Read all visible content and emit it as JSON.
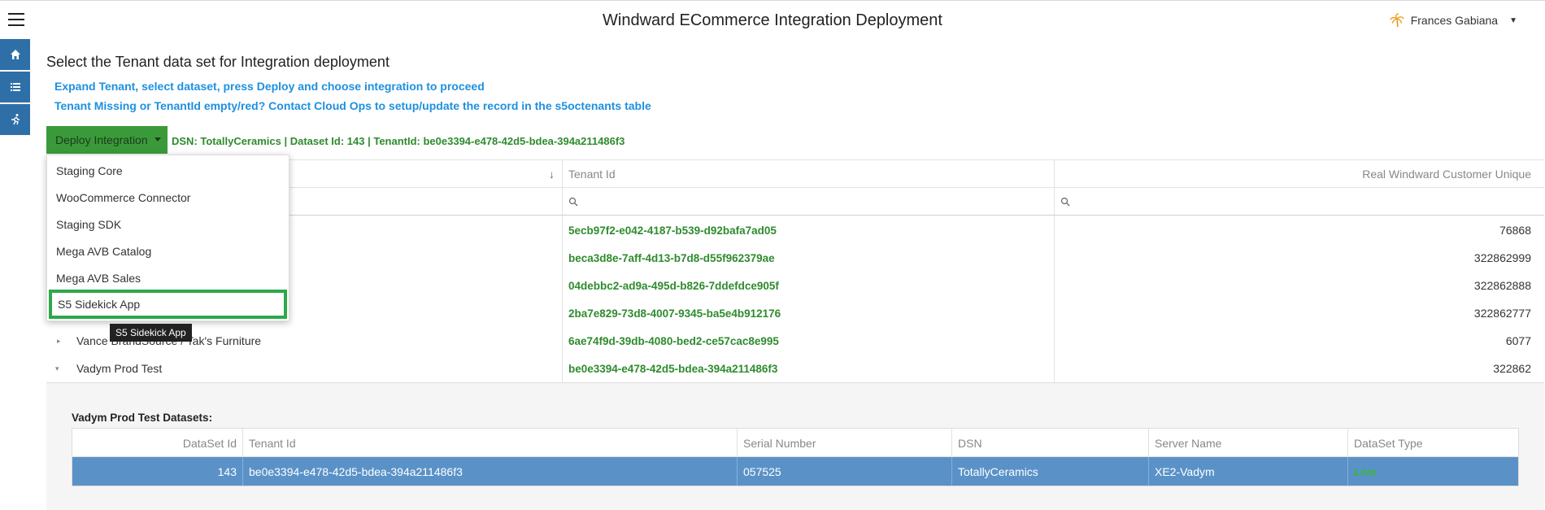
{
  "header": {
    "title": "Windward ECommerce Integration Deployment",
    "user_name": "Frances Gabiana"
  },
  "sidenav": {
    "items": [
      {
        "icon": "home-icon"
      },
      {
        "icon": "list-icon"
      },
      {
        "icon": "runner-icon"
      }
    ]
  },
  "page": {
    "heading": "Select the Tenant data set for Integration deployment",
    "info_line1": "Expand Tenant, select dataset, press Deploy and choose integration to proceed",
    "info_line2": "Tenant Missing or TenantId empty/red? Contact Cloud Ops to setup/update the record in the s5octenants table"
  },
  "deploy": {
    "button_label": "Deploy Integration",
    "dsn_info": "DSN: TotallyCeramics | Dataset Id: 143 | TenantId: be0e3394-e478-42d5-bdea-394a211486f3",
    "options": [
      "Staging Core",
      "WooCommerce Connector",
      "Staging SDK",
      "Mega AVB Catalog",
      "Mega AVB Sales",
      "S5 Sidekick App"
    ],
    "highlighted_option": "S5 Sidekick App",
    "tooltip": "S5 Sidekick App"
  },
  "grid": {
    "columns": [
      "Tenant Id",
      "Real Windward Customer Unique"
    ],
    "rows": [
      {
        "name": "",
        "tenant_id": "5ecb97f2-e042-4187-b539-d92bafa7ad05",
        "customer_unique": "76868"
      },
      {
        "name": "",
        "tenant_id": "beca3d8e-7aff-4d13-b7d8-d55f962379ae",
        "customer_unique": "322862999"
      },
      {
        "name": "",
        "tenant_id": "04debbc2-ad9a-495d-b826-7ddefdce905f",
        "customer_unique": "322862888"
      },
      {
        "name": "",
        "tenant_id": "2ba7e829-73d8-4007-9345-ba5e4b912176",
        "customer_unique": "322862777"
      },
      {
        "name": "Vance BrandSource / Tak's Furniture",
        "tenant_id": "6ae74f9d-39db-4080-bed2-ce57cac8e995",
        "customer_unique": "6077"
      },
      {
        "name": "Vadym Prod Test",
        "tenant_id": "be0e3394-e478-42d5-bdea-394a211486f3",
        "customer_unique": "322862"
      }
    ]
  },
  "detail": {
    "title": "Vadym Prod Test Datasets:",
    "columns": [
      "DataSet Id",
      "Tenant Id",
      "Serial Number",
      "DSN",
      "Server Name",
      "DataSet Type"
    ],
    "row": {
      "dataset_id": "143",
      "tenant_id": "be0e3394-e478-42d5-bdea-394a211486f3",
      "serial_number": "057525",
      "dsn": "TotallyCeramics",
      "server_name": "XE2-Vadym",
      "dataset_type": "Live"
    }
  },
  "colors": {
    "accent_blue": "#2f6fa8",
    "deploy_green": "#3a9a3a",
    "tenant_green": "#2e8b2e",
    "selected_row": "#5a92c8",
    "highlight_outline": "#2da84a"
  }
}
